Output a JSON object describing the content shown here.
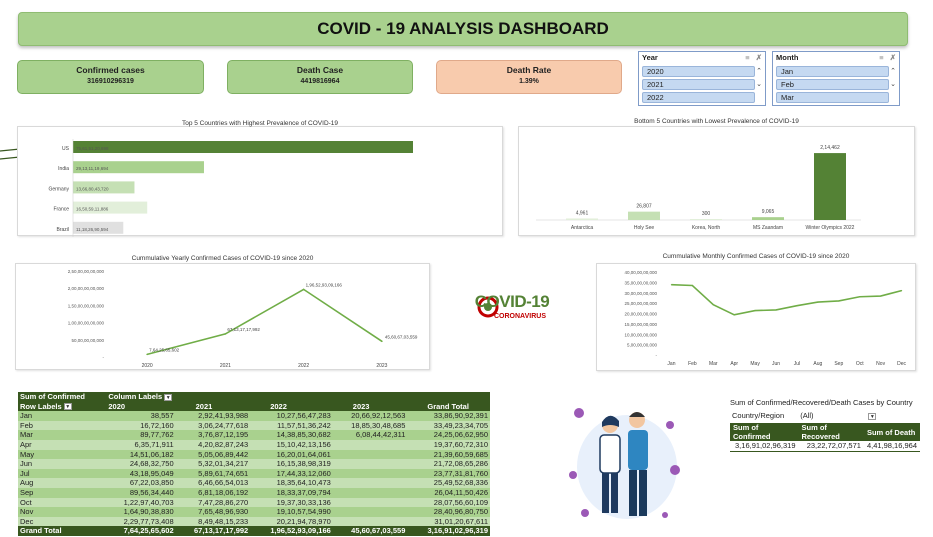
{
  "title": "COVID - 19 ANALYSIS DASHBOARD",
  "kpis": {
    "confirmed_label": "Confirmed cases",
    "confirmed_value": "316910296319",
    "death_label": "Death Case",
    "death_value": "4419816964",
    "rate_label": "Death Rate",
    "rate_value": "1.39%"
  },
  "slicers": {
    "year": {
      "title": "Year",
      "items": [
        "2020",
        "2021",
        "2022"
      ]
    },
    "month": {
      "title": "Month",
      "items": [
        "Jan",
        "Feb",
        "Mar"
      ]
    }
  },
  "logo": {
    "main": "COVID-19",
    "sub": "CORONAVIRUS"
  },
  "chart_data": [
    {
      "type": "bar",
      "orientation": "horizontal",
      "title": "Top 5 Countries with Highest Prevalence of COVID-19",
      "categories": [
        "US",
        "India",
        "Germany",
        "France",
        "Brazil"
      ],
      "values": [
        75615120698,
        29131119694,
        13668043720,
        16505911886,
        11182690594
      ],
      "labels": [
        "75,61,51,20,698",
        "29,13,11,19,694",
        "13,66,80,43,720",
        "16,50,59,11,886",
        "11,18,26,90,594"
      ],
      "colors": [
        "#548235",
        "#a9d18e",
        "#c5e0b4",
        "#e2efda",
        "#e0e0e0"
      ]
    },
    {
      "type": "bar",
      "title": "Bottom 5 Countries with Lowest Prevalence of COVID-19",
      "categories": [
        "Antarctica",
        "Holy See",
        "Korea, North",
        "MS Zaandam",
        "Winter Olympics 2022"
      ],
      "values": [
        4961,
        26807,
        300,
        9065,
        214462
      ],
      "labels": [
        "4,961",
        "26,807",
        "300",
        "9,065",
        "2,14,462"
      ],
      "colors": [
        "#e2efda",
        "#c5e0b4",
        "#e2efda",
        "#a9d18e",
        "#548235"
      ],
      "ylim": [
        0,
        250000
      ]
    },
    {
      "type": "line",
      "title": "Cummulative Yearly Confirmed Cases of COVID-19 since 2020",
      "x": [
        "2020",
        "2021",
        "2022",
        "2023"
      ],
      "values": [
        7642565602,
        67131717992,
        196529309166,
        45606703559
      ],
      "labels": [
        "7,64,25,65,602",
        "67,13,17,17,992",
        "1,96,52,93,09,166",
        "45,60,67,03,559"
      ],
      "yticks": [
        "2,50,00,00,00,000",
        "2,00,00,00,00,000",
        "1,50,00,00,00,000",
        "1,00,00,00,00,000",
        "50,00,00,00,000",
        "-"
      ],
      "ylim": [
        0,
        250000000000
      ],
      "color": "#70ad47"
    },
    {
      "type": "line",
      "title": "Cummulative Monthly Confirmed Cases of COVID-19 since 2020",
      "x": [
        "Jan",
        "Feb",
        "Mar",
        "Apr",
        "May",
        "Jun",
        "Jul",
        "Aug",
        "Sep",
        "Oct",
        "Nov",
        "Dec"
      ],
      "values": [
        33869092391,
        33493234705,
        24250662950,
        19370607310,
        21396059685,
        21720865286,
        23773181760,
        25495268336,
        26041150426,
        28075660109,
        28409680750,
        31012067611
      ],
      "yticks": [
        "40,00,00,00,000",
        "35,00,00,00,000",
        "30,00,00,00,000",
        "25,00,00,00,000",
        "20,00,00,00,000",
        "15,00,00,00,000",
        "10,00,00,00,000",
        "5,00,00,00,000",
        "-"
      ],
      "ylim": [
        0,
        40000000000
      ],
      "color": "#70ad47"
    }
  ],
  "pivot": {
    "corner": "Sum of Confirmed",
    "col_labels": "Column Labels",
    "row_labels": "Row Labels",
    "years": [
      "2020",
      "2021",
      "2022",
      "2023"
    ],
    "grand_total_label": "Grand Total",
    "rows": [
      {
        "m": "Jan",
        "v": [
          "38,557",
          "2,92,41,93,988",
          "10,27,56,47,283",
          "20,66,92,12,563",
          "33,86,90,92,391"
        ]
      },
      {
        "m": "Feb",
        "v": [
          "16,72,160",
          "3,06,24,77,618",
          "11,57,51,36,242",
          "18,85,30,48,685",
          "33,49,23,34,705"
        ]
      },
      {
        "m": "Mar",
        "v": [
          "89,77,762",
          "3,76,87,12,195",
          "14,38,85,30,682",
          "6,08,44,42,311",
          "24,25,06,62,950"
        ]
      },
      {
        "m": "Apr",
        "v": [
          "6,35,71,911",
          "4,20,82,87,243",
          "15,10,42,13,156",
          "",
          "19,37,60,72,310"
        ]
      },
      {
        "m": "May",
        "v": [
          "14,51,06,182",
          "5,05,06,89,442",
          "16,20,01,64,061",
          "",
          "21,39,60,59,685"
        ]
      },
      {
        "m": "Jun",
        "v": [
          "24,68,32,750",
          "5,32,01,34,217",
          "16,15,38,98,319",
          "",
          "21,72,08,65,286"
        ]
      },
      {
        "m": "Jul",
        "v": [
          "43,18,95,049",
          "5,89,61,74,651",
          "17,44,33,12,060",
          "",
          "23,77,31,81,760"
        ]
      },
      {
        "m": "Aug",
        "v": [
          "67,22,03,850",
          "6,46,66,54,013",
          "18,35,64,10,473",
          "",
          "25,49,52,68,336"
        ]
      },
      {
        "m": "Sep",
        "v": [
          "89,56,34,440",
          "6,81,18,06,192",
          "18,33,37,09,794",
          "",
          "26,04,11,50,426"
        ]
      },
      {
        "m": "Oct",
        "v": [
          "1,22,97,40,703",
          "7,47,28,86,270",
          "19,37,30,33,136",
          "",
          "28,07,56,60,109"
        ]
      },
      {
        "m": "Nov",
        "v": [
          "1,64,90,38,830",
          "7,65,48,96,930",
          "19,10,57,54,990",
          "",
          "28,40,96,80,750"
        ]
      },
      {
        "m": "Dec",
        "v": [
          "2,29,77,73,408",
          "8,49,48,15,233",
          "20,21,94,78,970",
          "",
          "31,01,20,67,611"
        ]
      }
    ],
    "totals": [
      "7,64,25,65,602",
      "67,13,17,17,992",
      "1,96,52,93,09,166",
      "45,60,67,03,559",
      "3,16,91,02,96,319"
    ]
  },
  "right_pivot": {
    "title": "Sum of Confirmed/Recovered/Death Cases by Country",
    "filter_label": "Country/Region",
    "filter_value": "(All)",
    "headers": [
      "Sum of Confirmed",
      "Sum of Recovered",
      "Sum of Death"
    ],
    "values": [
      "3,16,91,02,96,319",
      "23,22,72,07,571",
      "4,41,98,16,964"
    ]
  }
}
